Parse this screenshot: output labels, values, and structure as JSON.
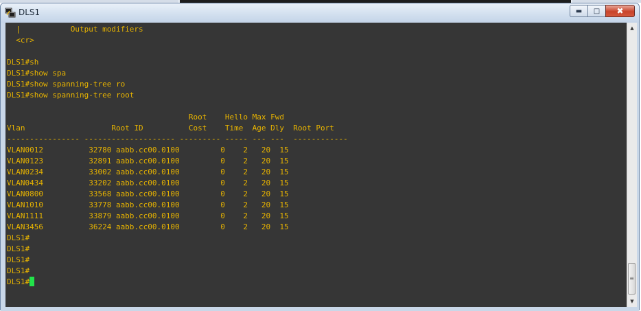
{
  "window": {
    "title": "DLS1",
    "icon": "putty-terminal-icon",
    "buttons": {
      "minimize": "minimize-icon",
      "maximize": "maximize-icon",
      "close": "close-icon"
    }
  },
  "terminal": {
    "lines": [
      "  |           Output modifiers",
      "  <cr>",
      "",
      "DLS1#sh",
      "DLS1#show spa",
      "DLS1#show spanning-tree ro",
      "DLS1#show spanning-tree root",
      "",
      "                                        Root    Hello Max Fwd",
      "Vlan                   Root ID          Cost    Time  Age Dly  Root Port",
      "---------------- -------------------- --------- ----- --- ---  ------------",
      "VLAN0012          32780 aabb.cc00.0100         0    2   20  15",
      "VLAN0123          32891 aabb.cc00.0100         0    2   20  15",
      "VLAN0234          33002 aabb.cc00.0100         0    2   20  15",
      "VLAN0434          33202 aabb.cc00.0100         0    2   20  15",
      "VLAN0800          33568 aabb.cc00.0100         0    2   20  15",
      "VLAN1010          33778 aabb.cc00.0100         0    2   20  15",
      "VLAN1111          33879 aabb.cc00.0100         0    2   20  15",
      "VLAN3456          36224 aabb.cc00.0100         0    2   20  15",
      "DLS1#",
      "DLS1#",
      "DLS1#",
      "DLS1#",
      "DLS1#"
    ],
    "text_color": "#e8b400",
    "background": "#363636",
    "cursor_color": "#22e34a"
  },
  "scrollbar": {
    "up_icon": "scroll-up-arrow-icon",
    "down_icon": "scroll-down-arrow-icon"
  }
}
